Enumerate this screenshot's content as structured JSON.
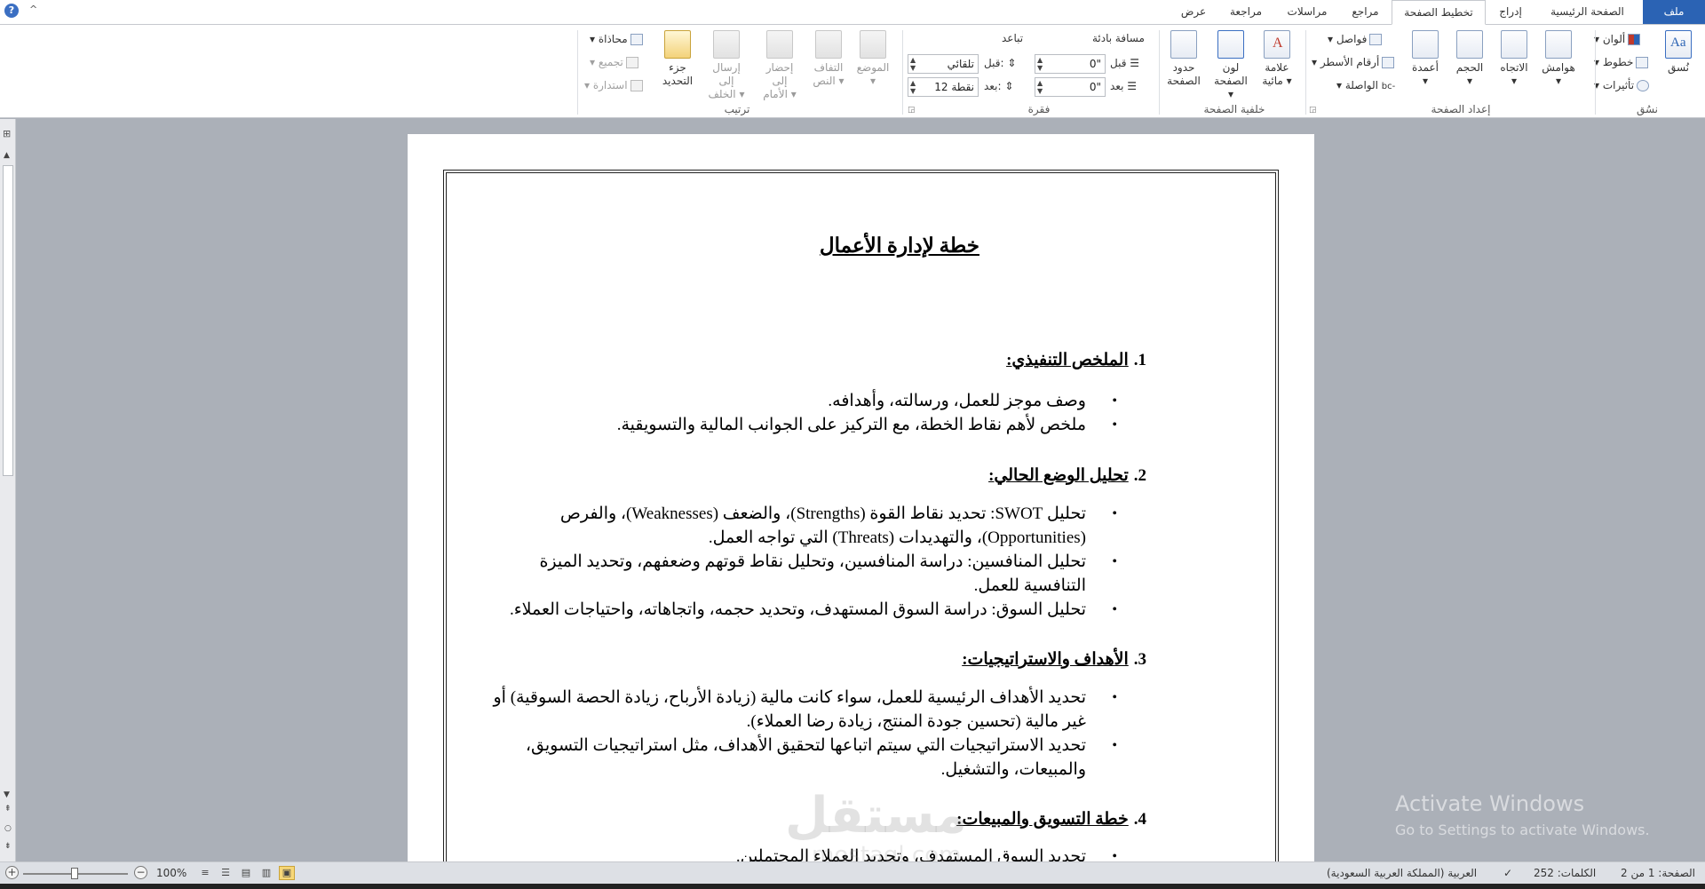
{
  "tabs": {
    "file": "ملف",
    "home": "الصفحة الرئيسية",
    "insert": "إدراج",
    "page_layout": "تخطيط الصفحة",
    "references": "مراجع",
    "mailings": "مراسلات",
    "review": "مراجعة",
    "view": "عرض"
  },
  "window": {
    "help": "?",
    "collapse": "^"
  },
  "ribbon": {
    "themes": {
      "group_label": "نسُق",
      "themes_btn": "نُسق",
      "colors": "ألوان",
      "fonts": "خطوط",
      "effects": "تأثيرات"
    },
    "page_setup": {
      "group_label": "إعداد الصفحة",
      "margins": "هوامش",
      "orientation": "الاتجاه",
      "size": "الحجم",
      "columns": "أعمدة",
      "breaks": "فواصل",
      "line_numbers": "أرقام الأسطر",
      "hyphenation": "الواصلة"
    },
    "page_background": {
      "group_label": "خلفية الصفحة",
      "watermark": "علامة مائية",
      "page_color": "لون الصفحة",
      "page_borders": "حدود الصفحة"
    },
    "paragraph": {
      "group_label": "فقرة",
      "indent_label": "مسافة بادئة",
      "spacing_label": "تباعد",
      "indent_before_label": "قبل",
      "indent_after_label": "بعد",
      "indent_before_value": "0\"",
      "indent_after_value": "0\"",
      "spacing_before_label": "قبل:",
      "spacing_after_label": "بعد:",
      "spacing_before_value": "تلقائي",
      "spacing_after_value": "12 نقطة"
    },
    "arrange": {
      "group_label": "ترتيب",
      "position": "الموضع",
      "wrap_text": "التفاف النص",
      "bring_forward": "إحضار إلى الأمام",
      "send_backward": "إرسال إلى الخلف",
      "selection_pane": "جزء التحديد",
      "align": "محاذاة",
      "group": "تجميع",
      "rotate": "استدارة"
    }
  },
  "document": {
    "title": "خطة لإدارة الأعمال",
    "sections": [
      {
        "num": "1.",
        "heading": "الملخص التنفيذي:",
        "bullets": [
          "وصف موجز للعمل، ورسالته، وأهدافه.",
          "ملخص لأهم نقاط الخطة، مع التركيز على الجوانب المالية والتسويقية."
        ]
      },
      {
        "num": "2.",
        "heading": "تحليل الوضع الحالي:",
        "bullets": [
          "تحليل SWOT: تحديد نقاط القوة (Strengths)، والضعف (Weaknesses)، والفرص (Opportunities)، والتهديدات (Threats) التي تواجه العمل.",
          "تحليل المنافسين: دراسة المنافسين، وتحليل نقاط قوتهم وضعفهم، وتحديد الميزة التنافسية للعمل.",
          "تحليل السوق: دراسة السوق المستهدف، وتحديد حجمه، واتجاهاته، واحتياجات العملاء."
        ]
      },
      {
        "num": "3.",
        "heading": "الأهداف والاستراتيجيات:",
        "bullets": [
          "تحديد الأهداف الرئيسية للعمل، سواء كانت مالية (زيادة الأرباح، زيادة الحصة السوقية) أو غير مالية (تحسين جودة المنتج، زيادة رضا العملاء).",
          "تحديد الاستراتيجيات التي سيتم اتباعها لتحقيق الأهداف، مثل استراتيجيات التسويق، والمبيعات، والتشغيل."
        ]
      },
      {
        "num": "4.",
        "heading": "خطة التسويق والمبيعات:",
        "bullets": [
          "تحديد السوق المستهدف، وتحديد العملاء المحتملين."
        ]
      }
    ]
  },
  "watermark": {
    "main": "مستقل",
    "sub": "mostaql.com"
  },
  "activation": {
    "line1": "Activate Windows",
    "line2": "Go to Settings to activate Windows."
  },
  "statusbar": {
    "page": "الصفحة: 1 من 2",
    "words": "الكلمات: 252",
    "language": "العربية (المملكة العربية السعودية)",
    "zoom": "100%",
    "zoom_level_percent": 100
  }
}
